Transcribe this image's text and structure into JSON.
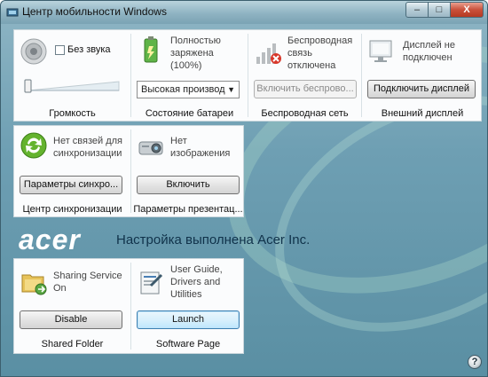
{
  "window": {
    "title": "Центр мобильности Windows",
    "controls": {
      "minimize": "–",
      "maximize": "□",
      "close": "X"
    }
  },
  "tiles": {
    "volume": {
      "mute_label": "Без звука",
      "mute_checked": false,
      "caption": "Громкость",
      "level": 0.0
    },
    "battery": {
      "status": "Полностью заряжена (100%)",
      "status_line1": "Полностью",
      "status_line2": "заряжена",
      "status_line3": "(100%)",
      "plan_select": "Высокая производ",
      "caption": "Состояние батареи"
    },
    "wireless": {
      "status_line1": "Беспроводная",
      "status_line2": "связь",
      "status_line3": "отключена",
      "button": "Включить беспрово...",
      "caption": "Беспроводная сеть"
    },
    "display": {
      "status_line1": "Дисплей не",
      "status_line2": "подключен",
      "button": "Подключить дисплей",
      "caption": "Внешний дисплей"
    },
    "sync": {
      "status_line1": "Нет связей для",
      "status_line2": "синхронизации",
      "button": "Параметры синхро...",
      "caption": "Центр синхронизации"
    },
    "presentation": {
      "status_line1": "Нет",
      "status_line2": "изображения",
      "button": "Включить",
      "caption": "Параметры презентац..."
    },
    "shared_folder": {
      "status_line1": "Sharing Service",
      "status_line2": "On",
      "button": "Disable",
      "caption": "Shared Folder"
    },
    "software_page": {
      "status_line1": "User Guide,",
      "status_line2": "Drivers and",
      "status_line3": "Utilities",
      "button": "Launch",
      "caption": "Software Page"
    }
  },
  "branding": {
    "logo_text": "acer",
    "tagline": "Настройка выполнена Acer Inc."
  },
  "help": {
    "label": "?"
  },
  "colors": {
    "background": "#6e9fb3",
    "tile": "#fbfcfd",
    "title_text": "#111111",
    "close_button": "#c9503a"
  }
}
